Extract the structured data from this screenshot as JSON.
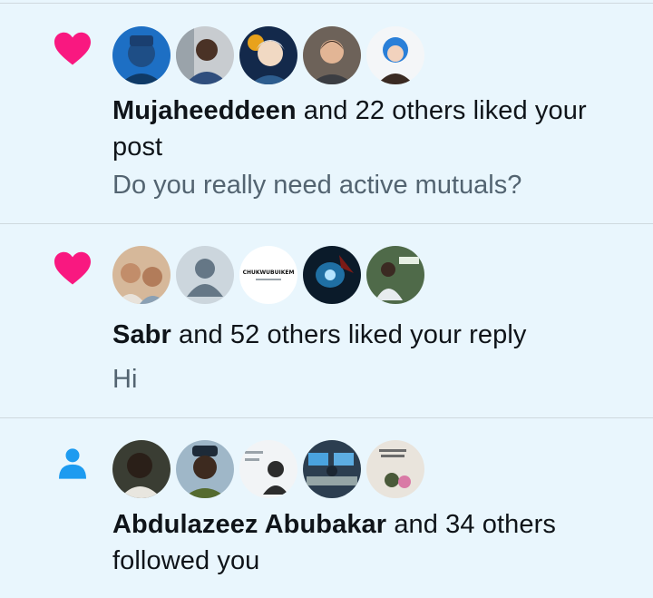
{
  "notifications": [
    {
      "type_icon": "heart-icon",
      "actor": "Mujaheeddeen",
      "action": " and 22 others liked your post",
      "snippet": "Do you really need active mutuals?"
    },
    {
      "type_icon": "heart-icon",
      "actor": "Sabr",
      "action": " and 52 others liked your reply",
      "snippet": "Hi"
    },
    {
      "type_icon": "person-icon",
      "actor": "Abdulazeez Abubakar",
      "action": " and 34 others followed you",
      "snippet": ""
    }
  ],
  "avatar_badge_text": "CHUKWUBUIKEM",
  "colors": {
    "like": "#f91880",
    "follow": "#1d9bf0",
    "background": "#e9f6fd",
    "secondary_text": "#536471"
  }
}
